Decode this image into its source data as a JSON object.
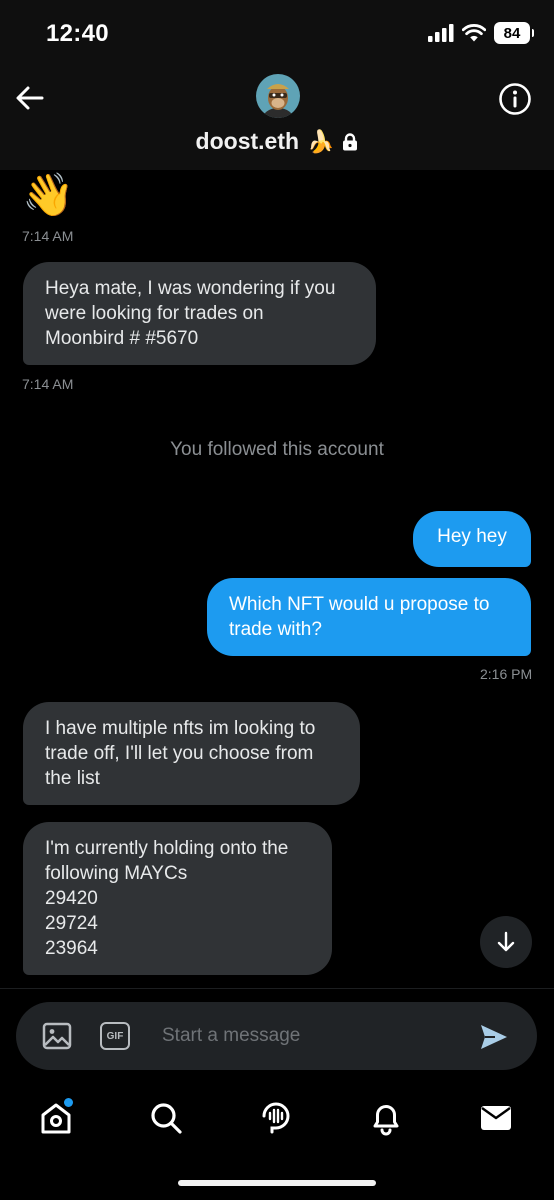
{
  "status_bar": {
    "time": "12:40",
    "battery": "84"
  },
  "header": {
    "name": "doost.eth",
    "name_emoji": "🍌"
  },
  "messages": {
    "wave_emoji": "👋",
    "wave_time": "7:14 AM",
    "m1_lines": [
      "Heya mate, I was wondering if you",
      "were looking for trades on",
      "Moonbird # #5670"
    ],
    "m1_time": "7:14 AM",
    "system": "You followed this account",
    "m2": "Hey hey",
    "m3_lines": [
      "Which NFT would u propose to",
      "trade with?"
    ],
    "m3_time": "2:16 PM",
    "m4_lines": [
      "I have multiple nfts im looking to",
      "trade off, I'll let you choose from",
      "the list"
    ],
    "m5_lines": [
      "I'm currently holding onto the",
      "following MAYCs",
      "29420",
      "29724",
      "23964"
    ]
  },
  "composer": {
    "placeholder": "Start a message",
    "gif_label": "GIF"
  },
  "colors": {
    "accent": "#1d9bf0",
    "incoming_bubble": "#303336",
    "background": "#000000"
  },
  "icons": [
    "back-arrow-icon",
    "info-icon",
    "image-icon",
    "gif-icon",
    "send-icon",
    "home-icon",
    "search-icon",
    "spaces-icon",
    "notifications-icon",
    "messages-icon",
    "arrow-down-icon"
  ]
}
